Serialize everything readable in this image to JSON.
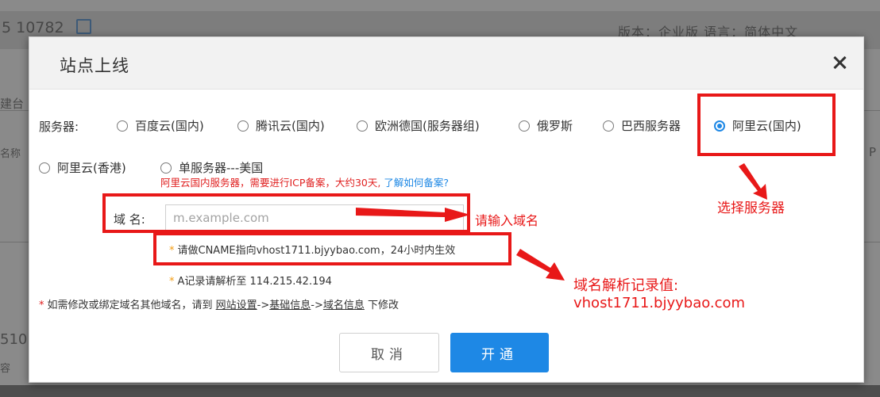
{
  "background": {
    "site_id": "5 10782",
    "version_text": "版本：企业版   语言：简体中文",
    "fragments": [
      "建台",
      "名称",
      "P",
      "510",
      "容"
    ]
  },
  "dialog": {
    "title": "站点上线",
    "server_label": "服务器:",
    "server_options": [
      {
        "label": "百度云(国内)",
        "checked": false
      },
      {
        "label": "腾讯云(国内)",
        "checked": false
      },
      {
        "label": "欧洲德国(服务器组)",
        "checked": false
      },
      {
        "label": "俄罗斯",
        "checked": false
      },
      {
        "label": "巴西服务器",
        "checked": false
      },
      {
        "label": "阿里云(国内)",
        "checked": true
      },
      {
        "label": "阿里云(香港)",
        "checked": false
      },
      {
        "label": "单服务器---美国",
        "checked": false
      }
    ],
    "icp_notice": "阿里云国内服务器，需要进行ICP备案，大约30天,",
    "icp_link": "了解如何备案?",
    "domain_label": "域 名:",
    "domain_placeholder": "m.example.com",
    "domain_value": "",
    "cname_hint_star": "*",
    "cname_hint": "请做CNAME指向vhost1711.bjyybao.com，24小时内生效",
    "arecord_hint_star": "*",
    "arecord_hint": "A记录请解析至 114.215.42.194",
    "modify_hint_star": "*",
    "modify_hint_prefix": "如需修改或绑定域名其他域名，请到",
    "modify_link_1": "网站设置",
    "modify_sep_1": "->",
    "modify_link_2": "基础信息",
    "modify_sep_2": "->",
    "modify_link_3": "域名信息",
    "modify_hint_suffix": "下修改",
    "cancel_label": "取消",
    "ok_label": "开通"
  },
  "annotations": {
    "select_server": "选择服务器",
    "enter_domain": "请输入域名",
    "record_value_title": "域名解析记录值:",
    "record_value": "vhost1711.bjyybao.com",
    "color": "#e81818"
  }
}
